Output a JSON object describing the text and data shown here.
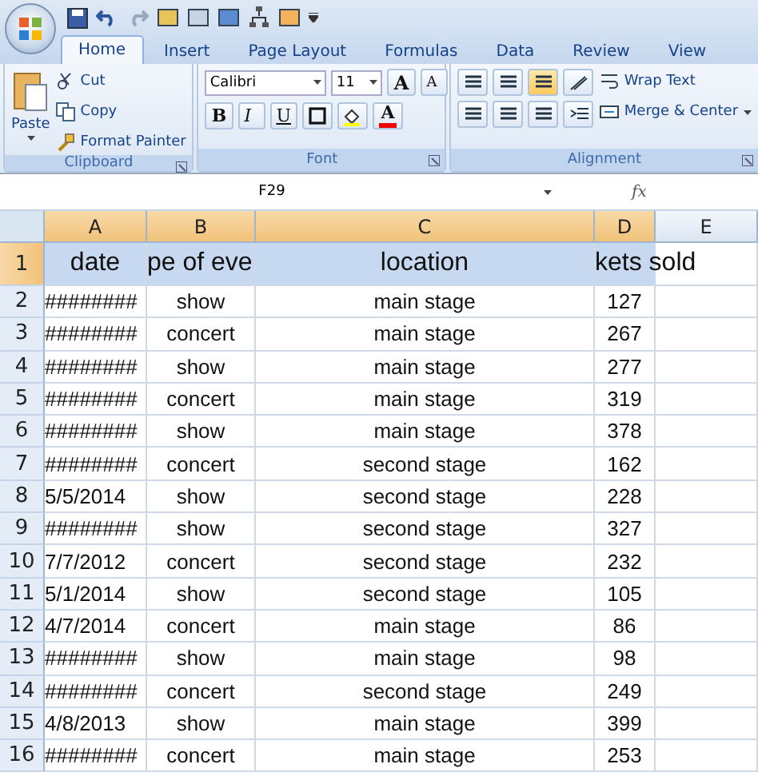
{
  "tabs": [
    {
      "label": "Home",
      "selected": true
    },
    {
      "label": "Insert",
      "selected": false
    },
    {
      "label": "Page Layout",
      "selected": false
    },
    {
      "label": "Formulas",
      "selected": false
    },
    {
      "label": "Data",
      "selected": false
    },
    {
      "label": "Review",
      "selected": false
    },
    {
      "label": "View",
      "selected": false
    }
  ],
  "ribbon": {
    "clipboard": {
      "label": "Clipboard",
      "paste": "Paste",
      "commands": [
        "Cut",
        "Copy",
        "Format Painter"
      ]
    },
    "font": {
      "label": "Font",
      "font_name": "Calibri",
      "font_size": "11",
      "grow": "A",
      "shrink": "A",
      "bold": "B",
      "italic": "I",
      "underline": "U",
      "font_color": "A"
    },
    "alignment": {
      "label": "Alignment",
      "wrap": "Wrap Text",
      "merge": "Merge & Center"
    }
  },
  "name_box": "F29",
  "function_label": "fx",
  "columns": [
    {
      "label": "A",
      "selected": true
    },
    {
      "label": "B",
      "selected": true
    },
    {
      "label": "C",
      "selected": true
    },
    {
      "label": "D",
      "selected": true
    },
    {
      "label": "E",
      "selected": false
    }
  ],
  "rows": [
    {
      "number": "1",
      "kind": "header",
      "selected": true,
      "cells": [
        "date",
        "pe of eve",
        "location",
        "kets sold"
      ]
    },
    {
      "number": "2",
      "kind": "data",
      "selected": false,
      "cells": [
        "########",
        "show",
        "main stage",
        "127"
      ]
    },
    {
      "number": "3",
      "kind": "data",
      "selected": false,
      "cells": [
        "########",
        "concert",
        "main stage",
        "267"
      ]
    },
    {
      "number": "4",
      "kind": "data",
      "selected": false,
      "cells": [
        "########",
        "show",
        "main stage",
        "277"
      ]
    },
    {
      "number": "5",
      "kind": "data",
      "selected": false,
      "cells": [
        "########",
        "concert",
        "main stage",
        "319"
      ]
    },
    {
      "number": "6",
      "kind": "data",
      "selected": false,
      "cells": [
        "########",
        "show",
        "main stage",
        "378"
      ]
    },
    {
      "number": "7",
      "kind": "data",
      "selected": false,
      "cells": [
        "########",
        "concert",
        "second stage",
        "162"
      ]
    },
    {
      "number": "8",
      "kind": "data",
      "selected": false,
      "cells": [
        "5/5/2014",
        "show",
        "second stage",
        "228"
      ]
    },
    {
      "number": "9",
      "kind": "data",
      "selected": false,
      "cells": [
        "########",
        "show",
        "second stage",
        "327"
      ]
    },
    {
      "number": "10",
      "kind": "data",
      "selected": false,
      "cells": [
        "7/7/2012",
        "concert",
        "second stage",
        "232"
      ]
    },
    {
      "number": "11",
      "kind": "data",
      "selected": false,
      "cells": [
        "5/1/2014",
        "show",
        "second stage",
        "105"
      ]
    },
    {
      "number": "12",
      "kind": "data",
      "selected": false,
      "cells": [
        "4/7/2014",
        "concert",
        "main stage",
        "86"
      ]
    },
    {
      "number": "13",
      "kind": "data",
      "selected": false,
      "cells": [
        "########",
        "show",
        "main stage",
        "98"
      ]
    },
    {
      "number": "14",
      "kind": "data",
      "selected": false,
      "cells": [
        "########",
        "concert",
        "second stage",
        "249"
      ]
    },
    {
      "number": "15",
      "kind": "data",
      "selected": false,
      "cells": [
        "4/8/2013",
        "show",
        "main stage",
        "399"
      ]
    },
    {
      "number": "16",
      "kind": "data",
      "selected": false,
      "cells": [
        "########",
        "concert",
        "main stage",
        "253"
      ]
    }
  ]
}
